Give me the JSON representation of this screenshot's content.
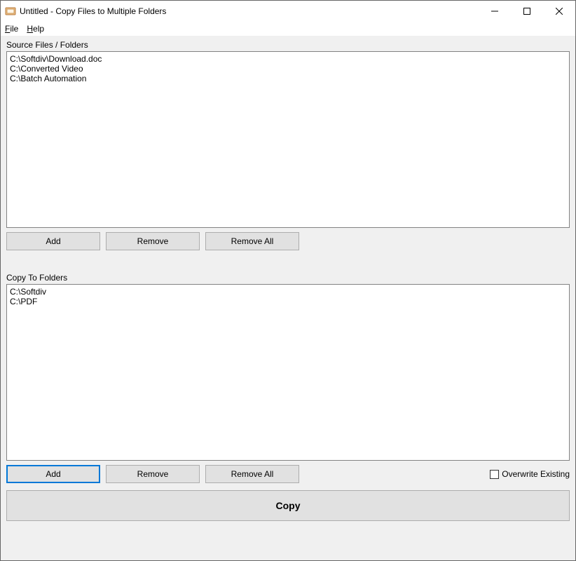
{
  "window": {
    "title": "Untitled - Copy Files to Multiple Folders"
  },
  "menu": {
    "file": "File",
    "help": "Help"
  },
  "source": {
    "label": "Source Files / Folders",
    "items": [
      "C:\\Softdiv\\Download.doc",
      "C:\\Converted Video",
      "C:\\Batch Automation"
    ],
    "buttons": {
      "add": "Add",
      "remove": "Remove",
      "remove_all": "Remove All"
    }
  },
  "dest": {
    "label": "Copy To Folders",
    "items": [
      "C:\\Softdiv",
      "C:\\PDF"
    ],
    "buttons": {
      "add": "Add",
      "remove": "Remove",
      "remove_all": "Remove All"
    },
    "overwrite_label": "Overwrite Existing",
    "overwrite_checked": false
  },
  "copy_button": "Copy"
}
